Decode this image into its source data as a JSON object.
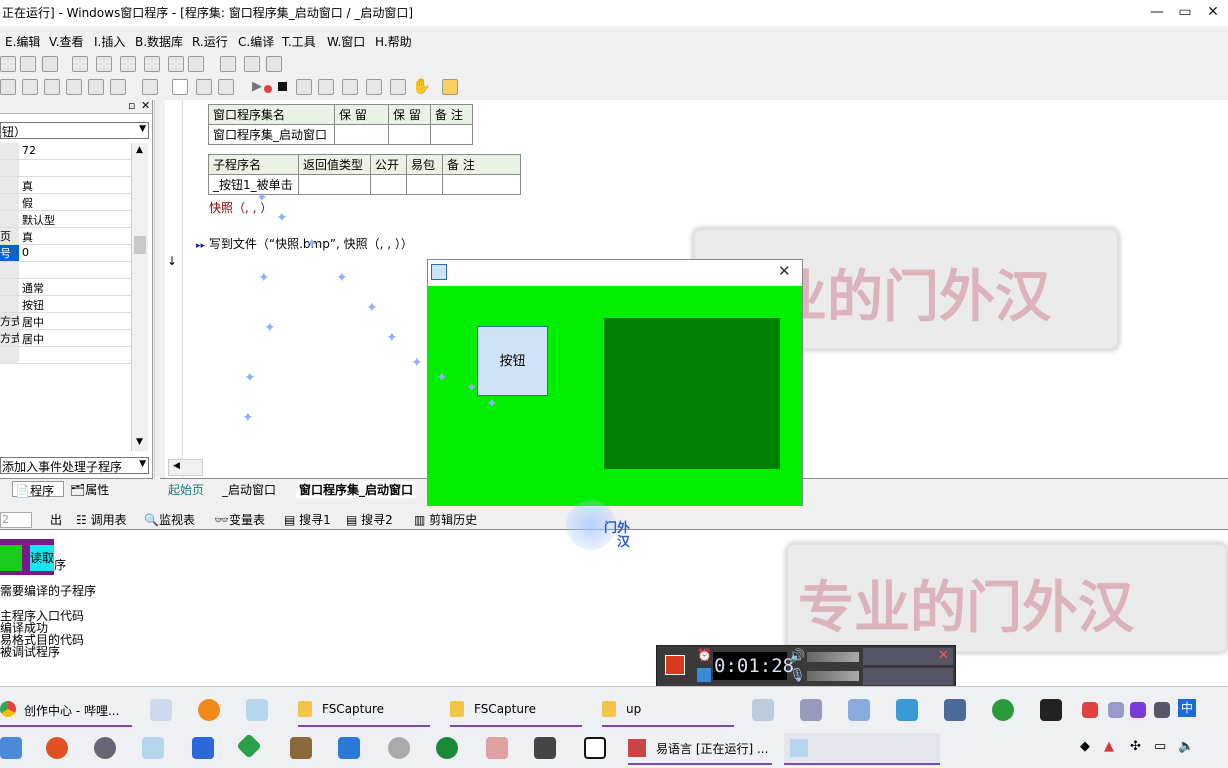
{
  "window": {
    "title": "正在运行] - Windows窗口程序 - [程序集: 窗口程序集_启动窗口 / _启动窗口]",
    "minimize": "—",
    "restore": "▭",
    "close": "✕"
  },
  "menu": [
    {
      "label": "E.编辑"
    },
    {
      "label": "V.查看"
    },
    {
      "label": "I.插入"
    },
    {
      "label": "B.数据库"
    },
    {
      "label": "R.运行"
    },
    {
      "label": "C.编译"
    },
    {
      "label": "T.工具"
    },
    {
      "label": "W.窗口"
    },
    {
      "label": "H.帮助"
    }
  ],
  "left_panel": {
    "type_combo": "钮）",
    "props": [
      {
        "key": "",
        "value": "72"
      },
      {
        "key": "",
        "value": ""
      },
      {
        "key": "",
        "value": "真"
      },
      {
        "key": "",
        "value": "假"
      },
      {
        "key": "",
        "value": "默认型"
      },
      {
        "key": "页",
        "value": "真"
      },
      {
        "key": "号",
        "value": "0"
      },
      {
        "key": "",
        "value": ""
      },
      {
        "key": "",
        "value": "通常"
      },
      {
        "key": "",
        "value": "按钮"
      },
      {
        "key": "方式",
        "value": "居中"
      },
      {
        "key": "方式",
        "value": "居中"
      },
      {
        "key": "",
        "value": ""
      }
    ],
    "event_combo": "添加入事件处理子程序",
    "tab_program": "程序",
    "tab_properties": "属性"
  },
  "editor": {
    "assembly_table": {
      "headers": [
        "窗口程序集名",
        "保 留",
        "保 留",
        "备 注"
      ],
      "row": [
        "窗口程序集_启动窗口",
        "",
        "",
        ""
      ]
    },
    "sub_table": {
      "headers": [
        "子程序名",
        "返回值类型",
        "公开",
        "易包",
        "备 注"
      ],
      "row": [
        "_按钮1_被单击",
        "",
        "",
        "",
        ""
      ]
    },
    "code_lines": [
      "快照（, , ）",
      "写到文件（“快照.bmp”, 快照（, , ））"
    ]
  },
  "doc_tabs": [
    "起始页",
    "_启动窗口",
    "窗口程序集_启动窗口"
  ],
  "lower_tabs": [
    "出",
    "调用表",
    "监视表",
    "变量表",
    "搜寻1",
    "搜寻2",
    "剪辑历史"
  ],
  "output": {
    "input_value": "2",
    "badge_read": "读取",
    "lines": [
      "序",
      "需要编译的子程序",
      "",
      "主程序入口代码",
      "编译成功",
      "易格式目的代码",
      "被调试程序"
    ]
  },
  "app_window": {
    "button_label": "按钮",
    "close": "✕",
    "client_color": "#00ee00",
    "panel_color": "#008000"
  },
  "watermark": {
    "text": "专业的门外汉"
  },
  "cursor_text": "门外汉",
  "recorder": {
    "timer": "0:01:28"
  },
  "taskbar": {
    "top_row": [
      {
        "label": "创作中心 - 哔哩..."
      },
      {
        "label": "FSCapture"
      },
      {
        "label": "FSCapture"
      },
      {
        "label": "up"
      }
    ],
    "bottom_row_active": "易语言 [正在运行] ...",
    "tray_lang": "中"
  }
}
